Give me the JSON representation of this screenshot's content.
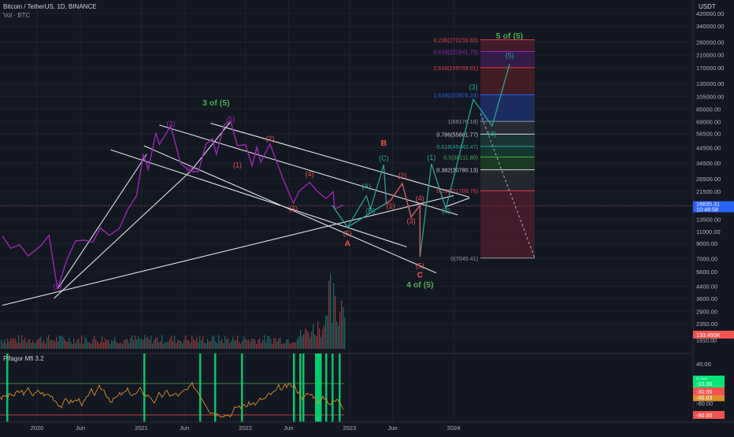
{
  "header": {
    "symbol_line": "Bitcoin / TetherUS, 1D, BINANCE",
    "volume_label": "Vol · BTC",
    "currency": "USDT",
    "indicator_label": "Pifagor Mfi 3.2"
  },
  "colors": {
    "background": "#131722",
    "price_line": "#9c27b0",
    "wave_green": "#26a69a",
    "wave_red": "#ef5350",
    "label_green": "#4caf50",
    "trendline": "#e0e3eb",
    "mfi_line": "#d9902c",
    "mfi_signal": "#00e676",
    "current_price_tag": "#2962ff"
  },
  "chart_data": [
    {
      "type": "line",
      "title": "Bitcoin / TetherUS, 1D, BINANCE",
      "y_scale": "log",
      "y_ticks": [
        "420000.00",
        "340000.00",
        "260000.00",
        "210000.00",
        "170000.00",
        "130000.00",
        "105000.00",
        "85000.00",
        "69000.00",
        "56500.00",
        "44500.00",
        "34500.00",
        "26500.00",
        "21500.00",
        "17000.00",
        "13500.00",
        "11000.00",
        "9000.00",
        "7000.00",
        "5600.00",
        "4400.00",
        "3600.00",
        "2900.00",
        "2350.00",
        "1910.00"
      ],
      "y_tick_values": [
        420000,
        340000,
        260000,
        210000,
        170000,
        130000,
        105000,
        85000,
        69000,
        56500,
        44500,
        34500,
        26500,
        21500,
        17000,
        13500,
        11000,
        9000,
        7000,
        5600,
        4400,
        3600,
        2900,
        2350,
        1910
      ],
      "x_ticks": [
        "2020",
        "Jun",
        "2021",
        "Jun",
        "2022",
        "Jun",
        "2023",
        "Jun",
        "2024"
      ],
      "x_tick_dates": [
        "2020-01-01",
        "2020-06-01",
        "2021-01-01",
        "2021-06-01",
        "2022-01-01",
        "2022-06-01",
        "2023-01-01",
        "2023-06-01",
        "2024-01-01"
      ],
      "price_series": {
        "name": "BTCUSDT",
        "points": [
          [
            "2019-09-01",
            10200
          ],
          [
            "2019-10-01",
            8300
          ],
          [
            "2019-11-01",
            8800
          ],
          [
            "2019-12-01",
            7300
          ],
          [
            "2020-01-15",
            8700
          ],
          [
            "2020-02-12",
            10300
          ],
          [
            "2020-03-13",
            4200
          ],
          [
            "2020-04-15",
            6900
          ],
          [
            "2020-05-15",
            9400
          ],
          [
            "2020-06-15",
            9500
          ],
          [
            "2020-07-15",
            9200
          ],
          [
            "2020-08-10",
            11700
          ],
          [
            "2020-09-10",
            10300
          ],
          [
            "2020-10-15",
            11500
          ],
          [
            "2020-11-15",
            16000
          ],
          [
            "2020-12-15",
            20000
          ],
          [
            "2021-01-08",
            40000
          ],
          [
            "2021-01-25",
            31000
          ],
          [
            "2021-02-21",
            57000
          ],
          [
            "2021-03-05",
            47000
          ],
          [
            "2021-04-14",
            64000
          ],
          [
            "2021-05-19",
            34000
          ],
          [
            "2021-06-22",
            30000
          ],
          [
            "2021-07-20",
            29800
          ],
          [
            "2021-08-15",
            47000
          ],
          [
            "2021-09-07",
            52000
          ],
          [
            "2021-09-21",
            40000
          ],
          [
            "2021-10-20",
            66000
          ],
          [
            "2021-11-10",
            68800
          ],
          [
            "2021-12-04",
            46000
          ],
          [
            "2022-01-01",
            47000
          ],
          [
            "2022-01-24",
            33000
          ],
          [
            "2022-02-10",
            45000
          ],
          [
            "2022-02-24",
            35000
          ],
          [
            "2022-03-28",
            47500
          ],
          [
            "2022-05-12",
            26700
          ],
          [
            "2022-06-18",
            17600
          ],
          [
            "2022-07-08",
            21500
          ],
          [
            "2022-08-14",
            25000
          ],
          [
            "2022-09-10",
            21500
          ],
          [
            "2022-10-10",
            19100
          ],
          [
            "2022-11-05",
            21300
          ],
          [
            "2022-11-10",
            16000
          ],
          [
            "2022-11-25",
            16500
          ],
          [
            "2022-12-10",
            17100
          ]
        ]
      },
      "current_price": "16835.31",
      "current_tag_line2": "10:48:58",
      "current_price_value": 16835.31
    },
    {
      "type": "bar",
      "title": "Vol · BTC",
      "last_value_label": "133.493K",
      "axis_tick": "1910.00"
    },
    {
      "type": "line",
      "title": "Pifagor Mfi 3.2",
      "y_ticks": [
        "40.00",
        "0.00",
        "-60.00",
        "-90.00"
      ],
      "y_tick_values": [
        40,
        0,
        -60,
        -90
      ],
      "tags": [
        {
          "label": "0.00",
          "value": 0,
          "color": "#00e676"
        },
        {
          "label": "-10.00",
          "value": -10,
          "color": "#00e676"
        },
        {
          "label": "-45.03",
          "value": -45.03,
          "color": "#d9902c"
        },
        {
          "label": "-30.00",
          "value": -30,
          "color": "#ef5350"
        },
        {
          "label": "-90.00",
          "value": -90,
          "color": "#ef5350"
        }
      ]
    }
  ],
  "fib_levels": [
    {
      "label": "4.236(270239.83)",
      "price": 270239.83,
      "color": "#f23645"
    },
    {
      "label": "3.618(221841.79)",
      "price": 221841.79,
      "color": "#9c27b0"
    },
    {
      "label": "2.618(169709.01)",
      "price": 169709.01,
      "color": "#f23645"
    },
    {
      "label": "1.618(107876.24)",
      "price": 107876.24,
      "color": "#2962ff"
    },
    {
      "label": "1(69176.18)",
      "price": 69176.18,
      "color": "#9598a1"
    },
    {
      "label": "0.786(55881.77)",
      "price": 55881.77,
      "color": "#d1d4dc"
    },
    {
      "label": "0.618(45443.47)",
      "price": 45443.47,
      "color": "#26a69a"
    },
    {
      "label": "0.5(38111.80)",
      "price": 38111.8,
      "color": "#4caf50"
    },
    {
      "label": "0.382(30780.13)",
      "price": 30780.13,
      "color": "#d1d4dc"
    },
    {
      "label": "0.236(21708.75)",
      "price": 21708.75,
      "color": "#f23645"
    },
    {
      "label": "0(7045.41)",
      "price": 7045.41,
      "color": "#9598a1"
    }
  ],
  "wave_labels": [
    {
      "text": "(2)",
      "date": "2020-03-13",
      "price": 4200,
      "color": "#9c27b0"
    },
    {
      "text": "(3)",
      "date": "2021-04-14",
      "price": 64000,
      "color": "#9c27b0"
    },
    {
      "text": "(4)",
      "date": "2021-06-22",
      "price": 30000,
      "color": "#9c27b0"
    },
    {
      "text": "(5)",
      "date": "2021-11-10",
      "price": 68800,
      "color": "#9c27b0"
    },
    {
      "text": "3 of (5)",
      "date": "2021-09-20",
      "price": 90000,
      "color": "#4caf50"
    },
    {
      "text": "(1)",
      "date": "2021-12-04",
      "price": 32000,
      "color": "#ef5350"
    },
    {
      "text": "(2)",
      "date": "2022-03-28",
      "price": 50000,
      "color": "#ef5350"
    },
    {
      "text": "(3)",
      "date": "2022-06-18",
      "price": 15500,
      "color": "#ef5350"
    },
    {
      "text": "(4)",
      "date": "2022-08-14",
      "price": 27500,
      "color": "#ef5350"
    },
    {
      "text": "(5)",
      "date": "2022-12-25",
      "price": 10200,
      "color": "#ef5350"
    },
    {
      "text": "A",
      "date": "2022-12-25",
      "price": 8600,
      "color": "#ef5350"
    },
    {
      "text": "(A)",
      "date": "2023-03-01",
      "price": 22500,
      "color": "#26a69a"
    },
    {
      "text": "(B)",
      "date": "2023-03-15",
      "price": 15000,
      "color": "#26a69a"
    },
    {
      "text": "(C)",
      "date": "2023-05-01",
      "price": 36000,
      "color": "#26a69a"
    },
    {
      "text": "B",
      "date": "2023-05-01",
      "price": 46000,
      "color": "#ef5350"
    },
    {
      "text": "(1)",
      "date": "2023-05-25",
      "price": 16200,
      "color": "#ef5350"
    },
    {
      "text": "(2)",
      "date": "2023-07-05",
      "price": 26800,
      "color": "#ef5350"
    },
    {
      "text": "(3)",
      "date": "2023-08-05",
      "price": 12600,
      "color": "#ef5350"
    },
    {
      "text": "(4)",
      "date": "2023-09-05",
      "price": 18400,
      "color": "#ef5350"
    },
    {
      "text": "(5)",
      "date": "2023-09-05",
      "price": 5950,
      "color": "#ef5350"
    },
    {
      "text": "C",
      "date": "2023-09-05",
      "price": 5100,
      "color": "#ef5350"
    },
    {
      "text": "4 of (5)",
      "date": "2023-09-05",
      "price": 4330,
      "color": "#4caf50"
    },
    {
      "text": "(1)",
      "date": "2023-10-15",
      "price": 36300,
      "color": "#26a69a"
    },
    {
      "text": "(2)",
      "date": "2023-12-05",
      "price": 15000,
      "color": "#26a69a"
    },
    {
      "text": "(3)",
      "date": "2024-03-10",
      "price": 118000,
      "color": "#26a69a"
    },
    {
      "text": "(4)",
      "date": "2024-05-15",
      "price": 54000,
      "color": "#26a69a"
    },
    {
      "text": "(5)",
      "date": "2024-07-15",
      "price": 200000,
      "color": "#26a69a"
    },
    {
      "text": "5 of (5)",
      "date": "2024-07-15",
      "price": 275000,
      "color": "#4caf50"
    }
  ],
  "projection_red": [
    [
      "2022-11-01",
      17000
    ],
    [
      "2022-12-25",
      11800
    ],
    [
      "2023-05-25",
      18500
    ],
    [
      "2023-07-05",
      24500
    ],
    [
      "2023-08-05",
      14000
    ],
    [
      "2023-09-05",
      17000
    ],
    [
      "2023-09-05",
      7200
    ],
    [
      "2023-10-15",
      34000
    ],
    [
      "2023-12-05",
      16200
    ],
    [
      "2024-03-10",
      100000
    ],
    [
      "2024-05-15",
      64000
    ],
    [
      "2024-07-15",
      180000
    ]
  ],
  "projection_green": [
    [
      "2022-12-25",
      11800
    ],
    [
      "2023-03-01",
      20000
    ],
    [
      "2023-03-15",
      16000
    ],
    [
      "2023-05-01",
      33500
    ],
    [
      "2023-05-10",
      17500
    ]
  ]
}
